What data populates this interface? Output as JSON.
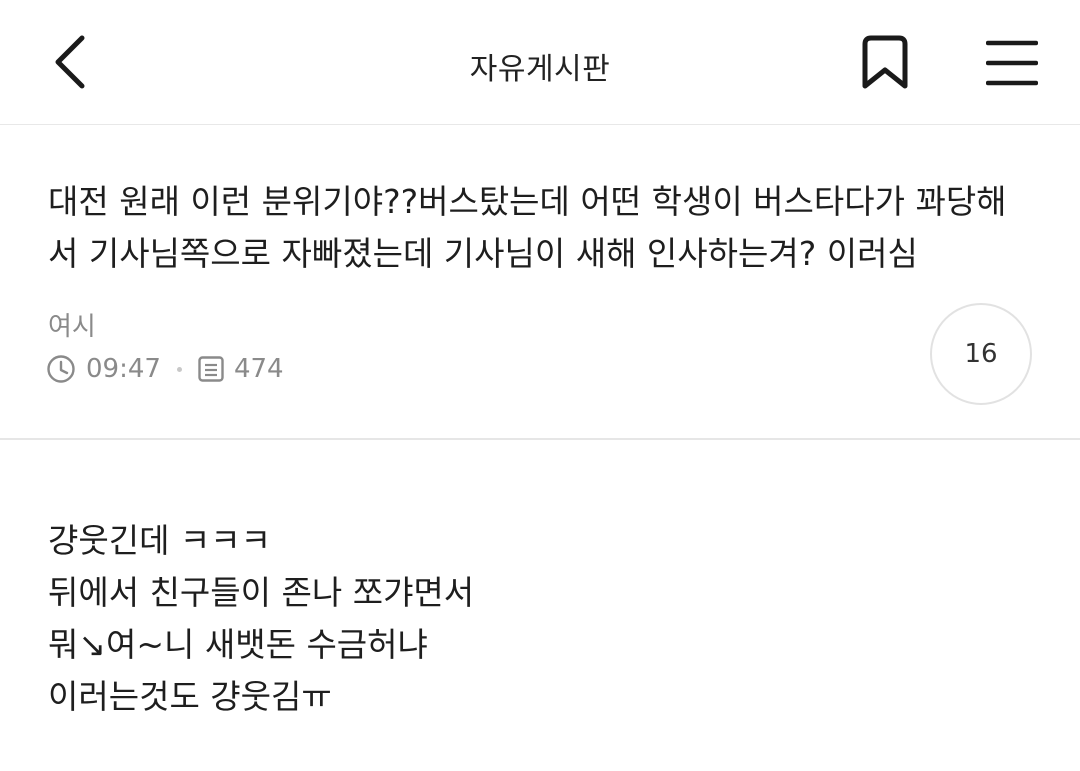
{
  "header": {
    "title": "자유게시판",
    "back_icon": "chevron-left-icon",
    "bookmark_icon": "bookmark-icon",
    "menu_icon": "hamburger-menu-icon"
  },
  "post": {
    "title": "대전 원래 이런 분위기야??버스탔는데 어떤 학생이 버스타다가 꽈당해서 기사님쪽으로 자빠졌는데 기사님이 새해 인사하는겨? 이러심",
    "author": "여시",
    "time": "09:47",
    "views": "474",
    "comment_count": "16",
    "body_lines": [
      "걍웃긴데 ㅋㅋㅋ",
      "뒤에서 친구들이 존나 쪼갸면서",
      "뭐↘여~니 새뱃돈 수금허냐",
      "이러는것도 걍웃김ㅠ"
    ]
  },
  "colors": {
    "text": "#1e1e1e",
    "meta": "#8a8a8a",
    "divider": "#e6e6e6"
  }
}
